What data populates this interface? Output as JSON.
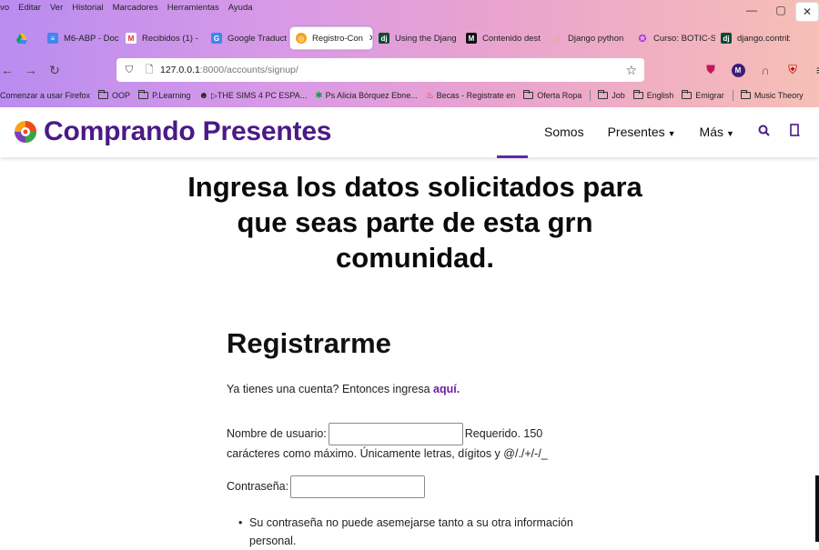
{
  "browser": {
    "menu": [
      "ivo",
      "Editar",
      "Ver",
      "Historial",
      "Marcadores",
      "Herramientas",
      "Ayuda"
    ],
    "tabs": [
      {
        "label": "",
        "icon": "drive-icon",
        "color": "#1a73e8"
      },
      {
        "label": "M6-ABP - Doc",
        "icon": "docs-icon",
        "color": "#4285f4"
      },
      {
        "label": "Recibidos (1) -",
        "icon": "gmail-icon",
        "color": "#d93025"
      },
      {
        "label": "Google Traduct",
        "icon": "translate-icon",
        "color": "#4285f4"
      },
      {
        "label": "Registro-Con",
        "icon": "site-logo-icon",
        "color": "#e94e1b",
        "active": true
      },
      {
        "label": "Using the Djang",
        "icon": "django-icon",
        "color": "#0c4b33"
      },
      {
        "label": "Contenido dest",
        "icon": "medium-icon",
        "color": "#111111"
      },
      {
        "label": "Django python",
        "icon": "hand-icon",
        "color": "#f0a030"
      },
      {
        "label": "Curso: BOTIC-S",
        "icon": "udemy-icon",
        "color": "#a435f0"
      },
      {
        "label": "django.contrib",
        "icon": "django-icon",
        "color": "#0c4b33"
      }
    ],
    "url_host": "127.0.0.1",
    "url_path": ":8000/accounts/signup/",
    "bookmarks": [
      {
        "label": "Comenzar a usar Firefox",
        "type": "link"
      },
      {
        "label": "OOP",
        "type": "folder"
      },
      {
        "label": "P.Learning",
        "type": "folder"
      },
      {
        "label": "▷THE SIMS 4 PC ESPA...",
        "type": "link",
        "sym": "☻"
      },
      {
        "label": "Ps Alicia Bórquez Ebne...",
        "type": "link",
        "sym": "✱"
      },
      {
        "label": "Becas - Registrate en",
        "type": "link",
        "sym": "♨"
      },
      {
        "label": "Oferta Ropa",
        "type": "folder"
      },
      {
        "label": "Job",
        "type": "folder"
      },
      {
        "label": "English",
        "type": "folder"
      },
      {
        "label": "Emigrar",
        "type": "folder"
      },
      {
        "label": "Music Theory",
        "type": "folder"
      }
    ]
  },
  "site": {
    "brand": "Comprando Presentes",
    "menu": {
      "somos": "Somos",
      "presentes": "Presentes",
      "mas": "Más"
    }
  },
  "page": {
    "headline": "Ingresa los datos solicitados para que seas parte de esta grn comunidad.",
    "form_title": "Registrarme",
    "login_prompt": "Ya tienes una cuenta? Entonces ingresa",
    "login_link": "aquí.",
    "username_label": "Nombre de usuario:",
    "username_help_a": "Requerido. 150",
    "username_help_b": "carácteres como máximo. Únicamente letras, dígitos y @/./+/-/_",
    "password_label": "Contraseña:",
    "password_rule_1": "Su contraseña no puede asemejarse tanto a su otra información",
    "password_rule_1b": "personal."
  }
}
